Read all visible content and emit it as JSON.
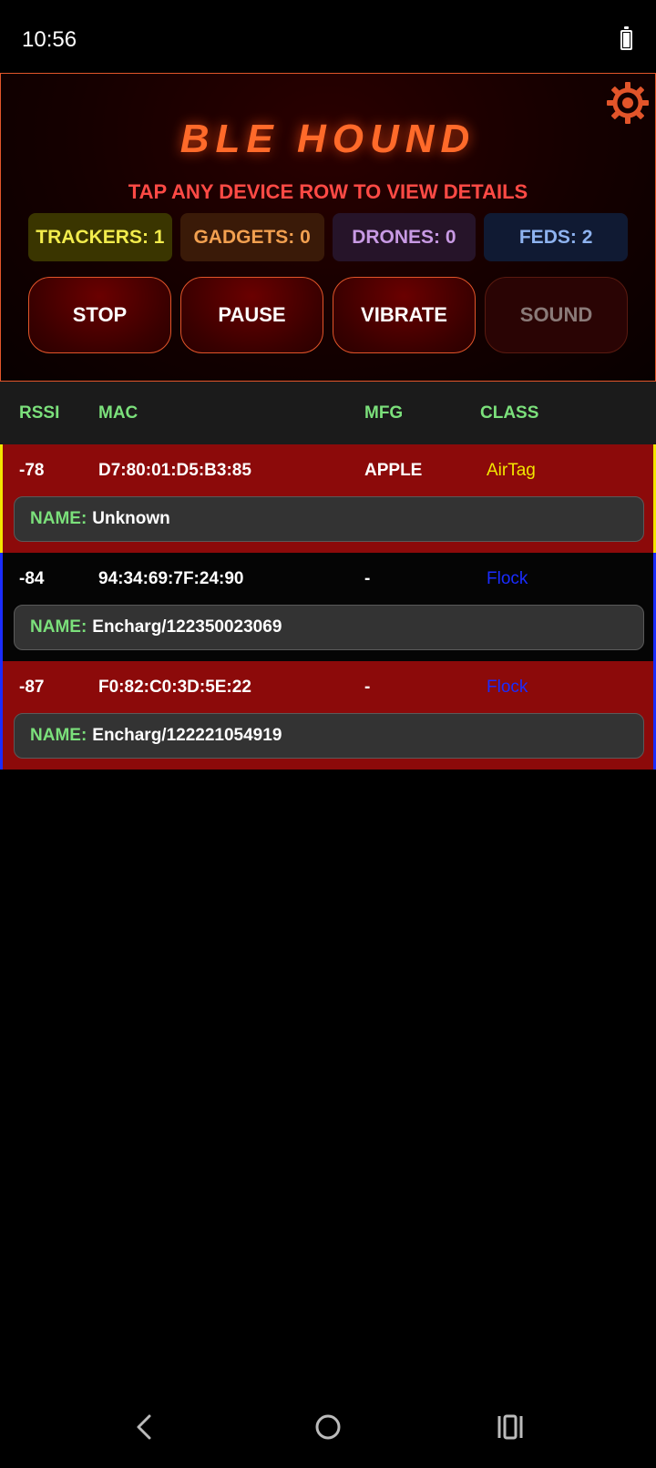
{
  "status_bar": {
    "time": "10:56",
    "battery_icon": "battery-full-icon",
    "battery_level": 1.0
  },
  "header": {
    "title": "BLE HOUND",
    "subtitle": "TAP ANY DEVICE ROW TO VIEW DETAILS",
    "settings_icon": "gear-icon",
    "accent_color": "#ff6a2a"
  },
  "counters": {
    "trackers": "TRACKERS: 1",
    "gadgets": "GADGETS: 0",
    "drones": "DRONES: 0",
    "feds": "FEDS: 2"
  },
  "controls": {
    "stop": "STOP",
    "pause": "PAUSE",
    "vibrate": "VIBRATE",
    "sound": "SOUND"
  },
  "table": {
    "columns": [
      "RSSI",
      "MAC",
      "MFG",
      "CLASS"
    ],
    "name_label": "NAME:",
    "rows": [
      {
        "rssi": "-78",
        "mac": "D7:80:01:D5:B3:85",
        "mfg": "APPLE",
        "class": "AirTag",
        "class_color": "#f2e600",
        "name": "Unknown",
        "frame_color": "#f2e600",
        "row_color": "#8c0a0a"
      },
      {
        "rssi": "-84",
        "mac": "94:34:69:7F:24:90",
        "mfg": "-",
        "class": "Flock",
        "class_color": "#1a2cff",
        "name": "Encharg/122350023069",
        "frame_color": "#1a2cff",
        "row_color": "#050505"
      },
      {
        "rssi": "-87",
        "mac": "F0:82:C0:3D:5E:22",
        "mfg": "-",
        "class": "Flock",
        "class_color": "#1a2cff",
        "name": "Encharg/122221054919",
        "frame_color": "#1a2cff",
        "row_color": "#8c0a0a"
      }
    ]
  },
  "nav_bar": {
    "back_icon": "back-icon",
    "home_icon": "home-icon",
    "recents_icon": "recents-icon"
  }
}
